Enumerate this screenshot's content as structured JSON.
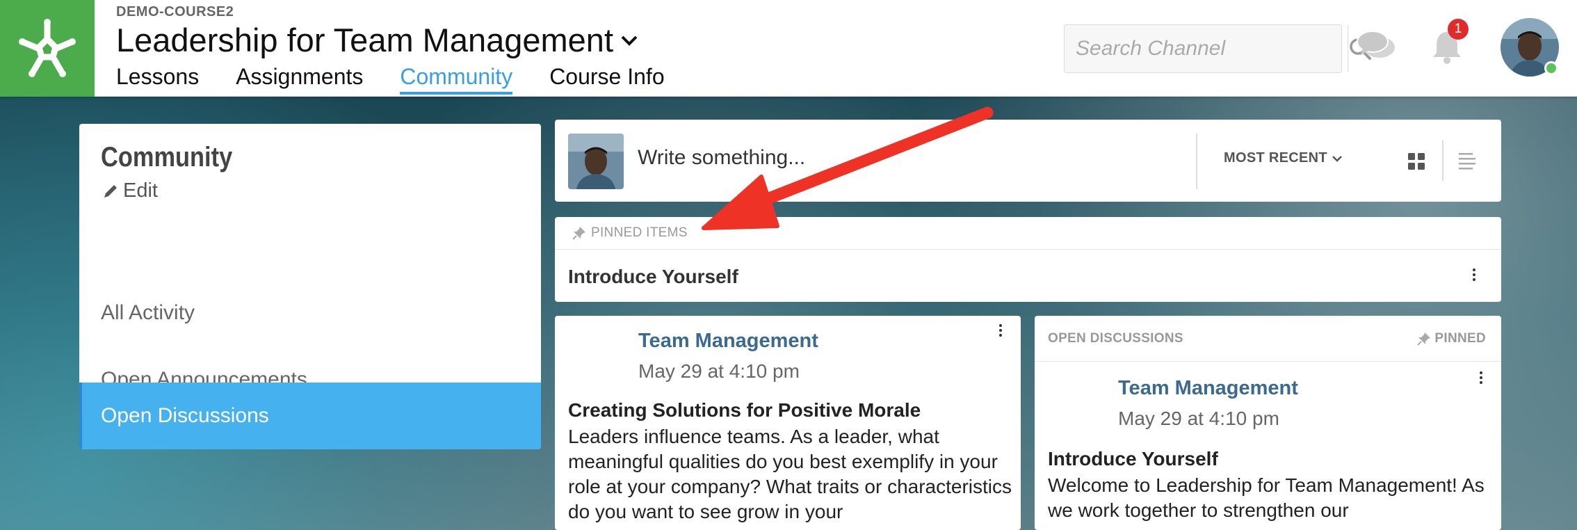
{
  "header": {
    "course_code": "DEMO-COURSE2",
    "course_title": "Leadership for Team Management",
    "tabs": [
      {
        "label": "Lessons"
      },
      {
        "label": "Assignments"
      },
      {
        "label": "Community",
        "active": true
      },
      {
        "label": "Course Info"
      }
    ],
    "search_placeholder": "Search Channel",
    "notification_count": "1",
    "accent_color": "#3a9fe0",
    "brand_color": "#4cab4a"
  },
  "sidebar": {
    "title": "Community",
    "edit_label": "Edit",
    "items": [
      {
        "label": "All Activity"
      },
      {
        "label": "Open Announcements"
      },
      {
        "label": "Open Discussions",
        "active": true
      }
    ]
  },
  "composer": {
    "placeholder": "Write something...",
    "sort_label": "MOST RECENT"
  },
  "pinned": {
    "header": "PINNED ITEMS",
    "items": [
      {
        "title": "Introduce Yourself"
      }
    ]
  },
  "posts": [
    {
      "author": "Team Management",
      "date": "May 29 at 4:10 pm",
      "title": "Creating Solutions for Positive Morale",
      "body": "Leaders influence teams. As a leader, what meaningful qualities do you best exemplify in your role at your company? What traits or characteristics do you want to see grow in your"
    },
    {
      "category": "OPEN DISCUSSIONS",
      "pinned_label": "PINNED",
      "author": "Team Management",
      "date": "May 29 at 4:10 pm",
      "title": "Introduce Yourself",
      "body": "Welcome to Leadership for Team Management! As we work together to strengthen our"
    }
  ]
}
